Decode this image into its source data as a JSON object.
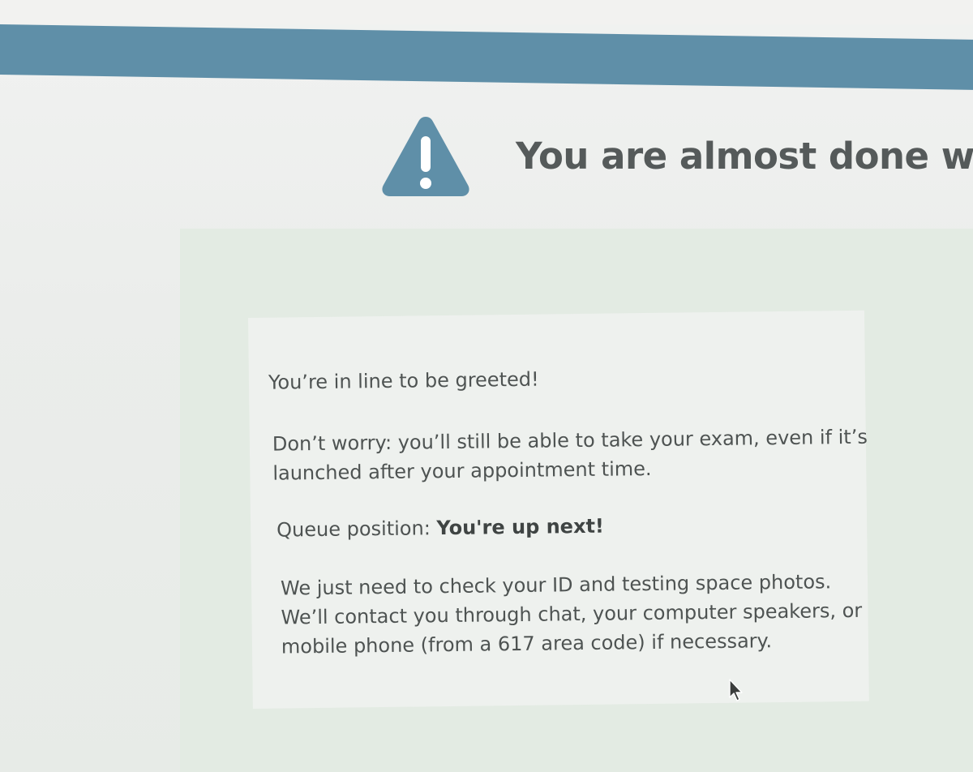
{
  "header": {
    "title": "You are almost done with",
    "icon": "warning-icon",
    "bar_color": "#5f8fa8"
  },
  "message": {
    "greeting": "You’re in line to be greeted!",
    "reassurance_line1": "Don’t worry: you’ll still be able to take your exam, even if it’s",
    "reassurance_line2": "launched after your appointment time.",
    "queue_label": "Queue position:",
    "queue_value": "You're up next!",
    "check_line1": "We just need to check your ID and testing space photos.",
    "check_line2": "We’ll contact you through chat, your computer speakers, or",
    "check_line3": "mobile phone (from a 617 area code) if necessary."
  }
}
